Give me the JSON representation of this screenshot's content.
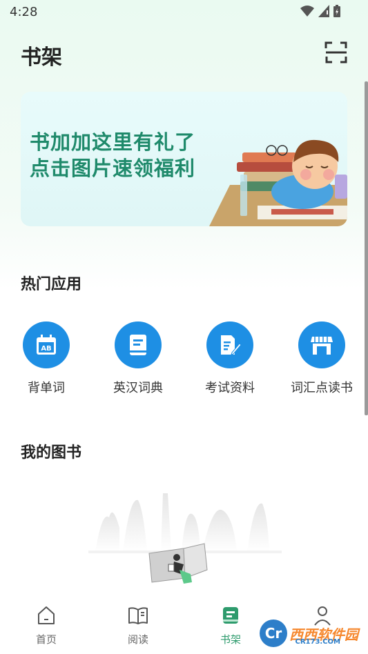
{
  "status": {
    "time": "4:28"
  },
  "header": {
    "title": "书架",
    "scan_icon": "scan-icon"
  },
  "banner": {
    "line1": "书加加这里有礼了",
    "line2": "点击图片速领福利"
  },
  "hot_apps": {
    "title": "热门应用",
    "items": [
      {
        "label": "背单词",
        "icon": "ab-calendar-icon"
      },
      {
        "label": "英汉词典",
        "icon": "book-icon"
      },
      {
        "label": "考试资料",
        "icon": "document-pen-icon"
      },
      {
        "label": "词汇点读书",
        "icon": "store-icon"
      }
    ]
  },
  "my_books": {
    "title": "我的图书"
  },
  "tabs": [
    {
      "label": "首页",
      "icon": "home-icon",
      "active": false
    },
    {
      "label": "阅读",
      "icon": "open-book-icon",
      "active": false
    },
    {
      "label": "书架",
      "icon": "bookshelf-icon",
      "active": true
    },
    {
      "label": "",
      "icon": "profile-icon",
      "active": false
    }
  ],
  "watermark": {
    "text": "西西软件园",
    "sub": "CR173.COM"
  },
  "colors": {
    "accent": "#2e9b6d",
    "app_blue": "#1e8fe4",
    "banner_text": "#1f8a6b"
  }
}
